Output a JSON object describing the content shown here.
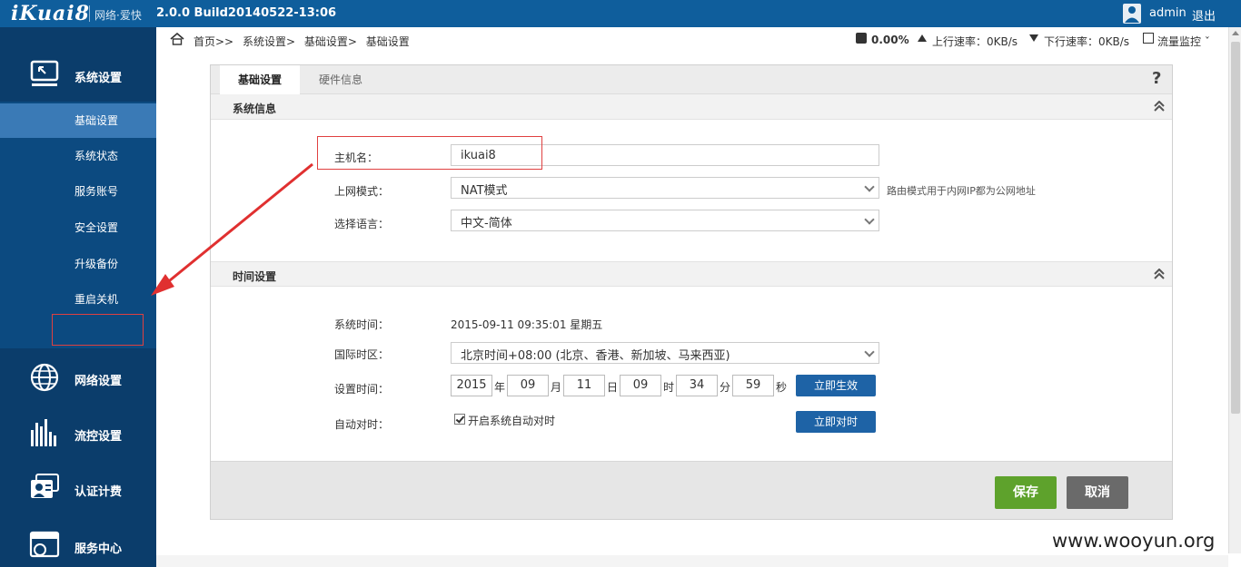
{
  "topbar": {
    "logo": "iKuai8",
    "slogan": "网络·爱快",
    "version": "2.0.0 Build20140522-13:06",
    "username": "admin",
    "logout": "退出"
  },
  "breadcrumb": {
    "items": [
      "首页>>",
      "系统设置>",
      "基础设置>",
      "基础设置"
    ]
  },
  "status": {
    "cpu": "0.00%",
    "upload_label": "上行速率：",
    "upload_value": "0KB/s",
    "download_label": "下行速率：",
    "download_value": "0KB/s",
    "flow_monitor": "流量监控"
  },
  "sidebar": {
    "groups": [
      {
        "label": "系统设置",
        "icon": "monitor-icon"
      },
      {
        "label": "网络设置",
        "icon": "globe-icon"
      },
      {
        "label": "流控设置",
        "icon": "bars-icon"
      },
      {
        "label": "认证计费",
        "icon": "id-card-icon"
      },
      {
        "label": "服务中心",
        "icon": "browser-icon"
      }
    ],
    "sub_items": [
      "基础设置",
      "系统状态",
      "服务账号",
      "安全设置",
      "升级备份",
      "重启关机"
    ]
  },
  "tabs": [
    "基础设置",
    "硬件信息"
  ],
  "help": "?",
  "system_info": {
    "title": "系统信息",
    "hostname_label": "主机名：",
    "hostname_value": "ikuai8",
    "mode_label": "上网模式：",
    "mode_value": "NAT模式",
    "mode_hint": "路由模式用于内网IP都为公网地址",
    "lang_label": "选择语言：",
    "lang_value": "中文-简体"
  },
  "time_settings": {
    "title": "时间设置",
    "systime_label": "系统时间：",
    "systime_value": "2015-09-11 09:35:01 星期五",
    "tz_label": "国际时区：",
    "tz_value": "北京时间+08:00 (北京、香港、新加坡、马来西亚)",
    "settime_label": "设置时间：",
    "year": "2015",
    "year_unit": "年",
    "month": "09",
    "month_unit": "月",
    "day": "11",
    "day_unit": "日",
    "hour": "09",
    "hour_unit": "时",
    "minute": "34",
    "minute_unit": "分",
    "second": "59",
    "second_unit": "秒",
    "apply_btn": "立即生效",
    "autosync_label": "自动对时：",
    "autosync_checkbox": "开启系统自动对时",
    "autosync_checked": true,
    "sync_btn": "立即对时"
  },
  "footer": {
    "save": "保存",
    "cancel": "取消"
  },
  "watermark": "www.wooyun.org",
  "colors": {
    "topbar": "#0f5e9c",
    "sidebar": "#0b3d6b",
    "sidebar_active": "#3a7ab6",
    "save_button": "#5ea22c",
    "primary_button": "#1e63a6",
    "annotation": "#e04040"
  }
}
